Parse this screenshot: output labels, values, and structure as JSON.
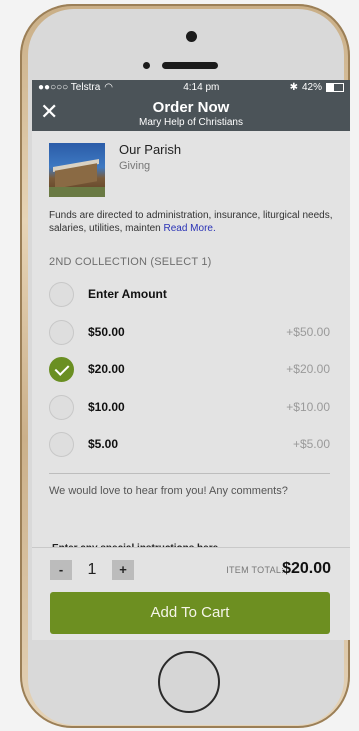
{
  "statusbar": {
    "carrier": "●●○○○ Telstra",
    "time": "4:14 pm",
    "battery_text": "42%",
    "battery_level": 0.42
  },
  "header": {
    "title": "Order Now",
    "subtitle": "Mary Help of Christians",
    "close_icon": "close-icon"
  },
  "product": {
    "name": "Our Parish",
    "category": "Giving"
  },
  "description": {
    "text": "Funds are directed to administration, insurance, liturgical needs, salaries, utilities, mainten",
    "read_more": "Read More."
  },
  "collection": {
    "label": "2ND COLLECTION (SELECT 1)",
    "options": [
      {
        "label": "Enter Amount",
        "price": "",
        "selected": false
      },
      {
        "label": "$50.00",
        "price": "+$50.00",
        "selected": false
      },
      {
        "label": "$20.00",
        "price": "+$20.00",
        "selected": true
      },
      {
        "label": "$10.00",
        "price": "+$10.00",
        "selected": false
      },
      {
        "label": "$5.00",
        "price": "+$5.00",
        "selected": false
      }
    ]
  },
  "comments": {
    "prompt": "We would love to hear from you! Any comments?",
    "placeholder": "Enter any special instructions here"
  },
  "footer": {
    "minus_label": "-",
    "plus_label": "+",
    "quantity": "1",
    "total_label": "ITEM TOTAL:",
    "total_value": "$20.00",
    "add_to_cart": "Add To Cart"
  },
  "colors": {
    "header_bg": "#4b5358",
    "accent_green": "#6d8f21",
    "link_blue": "#2a33b6"
  }
}
